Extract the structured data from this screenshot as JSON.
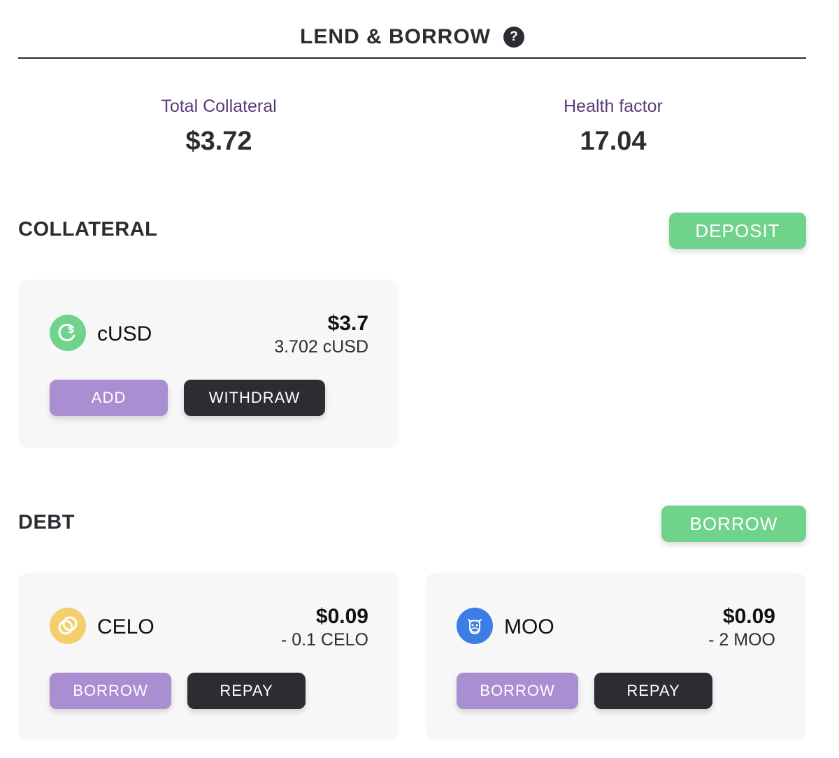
{
  "header": {
    "title": "LEND & BORROW",
    "help_glyph": "?"
  },
  "stats": {
    "total_collateral_label": "Total Collateral",
    "total_collateral_value": "$3.72",
    "health_factor_label": "Health factor",
    "health_factor_value": "17.04"
  },
  "collateral": {
    "title": "COLLATERAL",
    "deposit_label": "DEPOSIT",
    "items": [
      {
        "token": "cUSD",
        "icon": "cusd-icon",
        "usd": "$3.7",
        "amount": "3.702 cUSD",
        "add_label": "ADD",
        "withdraw_label": "WITHDRAW"
      }
    ]
  },
  "debt": {
    "title": "DEBT",
    "borrow_label": "BORROW",
    "items": [
      {
        "token": "CELO",
        "icon": "celo-icon",
        "usd": "$0.09",
        "amount": "- 0.1 CELO",
        "borrow_label": "BORROW",
        "repay_label": "REPAY"
      },
      {
        "token": "MOO",
        "icon": "moo-icon",
        "usd": "$0.09",
        "amount": "- 2 MOO",
        "borrow_label": "BORROW",
        "repay_label": "REPAY"
      }
    ]
  },
  "colors": {
    "green": "#6fd38b",
    "purple": "#a98fd1",
    "dark": "#2b2d33",
    "label_purple": "#5b3b77",
    "celo_yellow": "#f5cf6e",
    "moo_blue": "#3d7ee6"
  }
}
